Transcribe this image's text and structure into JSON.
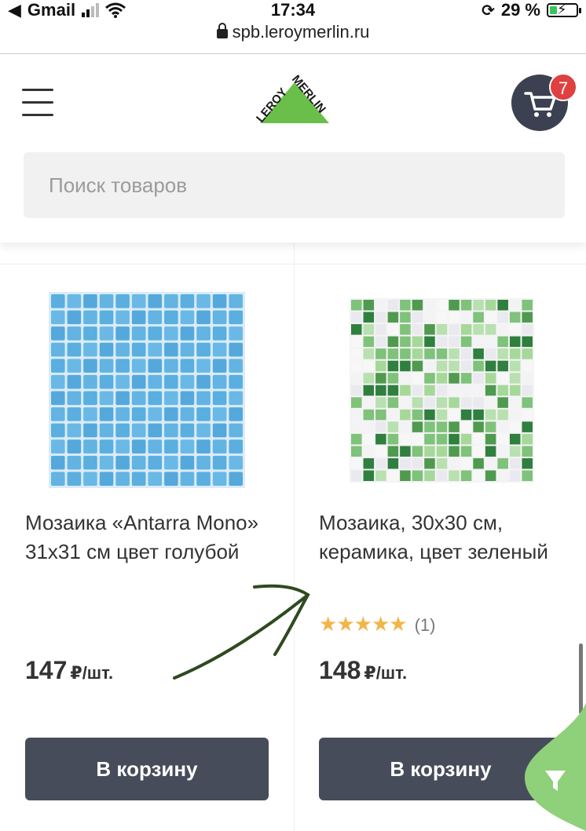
{
  "status": {
    "carrier": "Gmail",
    "time": "17:34",
    "battery": "29 %"
  },
  "browser": {
    "url": "spb.leroymerlin.ru"
  },
  "header": {
    "logo_text": "LEROY MERLIN",
    "cart_count": "7",
    "search_placeholder": "Поиск товаров"
  },
  "products": [
    {
      "title": "Мозаика «Antarra Mono» 31x31 см цвет голубой",
      "price": "147",
      "unit": "₽/шт.",
      "button": "В корзину"
    },
    {
      "title": "Мозаика, 30x30 см, керамика, цвет зеленый",
      "rating_count": "(1)",
      "rating": 5,
      "price": "148",
      "unit": "₽/шт.",
      "button": "В корзину"
    }
  ],
  "colors": {
    "brand_green": "#6abf4b",
    "button": "#474c5b",
    "cart": "#3b4150",
    "badge": "#e04040",
    "star": "#f2b54a"
  }
}
